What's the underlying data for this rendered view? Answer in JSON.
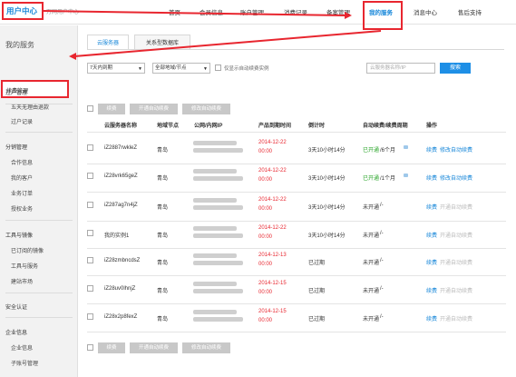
{
  "header": {
    "logo": "用户中心",
    "logo_sub": "万网用户中心",
    "nav": [
      "首页",
      "会员信息",
      "账户管理",
      "消费记录",
      "备案管理",
      "我的服务",
      "消息中心",
      "售后支持"
    ]
  },
  "sidebar": {
    "title": "我的服务",
    "active": "续费管理",
    "items": [
      "过户管理",
      "五天无理由退款",
      "过户记录",
      "分销管理",
      "合作信息",
      "我的客户",
      "业务订单",
      "授权业务",
      "工具与镜像",
      "已订阅的镜像",
      "工具与服务",
      "建站市场",
      "安全认证",
      "企业信息",
      "企业信息",
      "子账号管理"
    ]
  },
  "tabs": [
    "云服务器",
    "关系型数据库"
  ],
  "filters": {
    "expire_select": "7天内到期",
    "region_select": "全部地域/节点",
    "only_auto_label": "仅显示自动续费实例",
    "search_placeholder": "云服务器名称/IP",
    "search_button": "搜索"
  },
  "bulk_actions": [
    "续费",
    "开通自动续费",
    "修改自动续费"
  ],
  "table": {
    "columns": [
      "云服务器名称",
      "地域节点",
      "公网/内网IP",
      "产品到期时间",
      "倒计时",
      "自动续费/续费周期",
      "操作"
    ],
    "rows": [
      {
        "name": "iZ2887rwkleZ",
        "region": "青岛",
        "expire_date": "2014-12-22",
        "expire_time": "00:00",
        "countdown": "3天10小时14分",
        "auto": "已开通",
        "period": "/6个月",
        "actions": [
          "续费",
          "修改自动续费"
        ]
      },
      {
        "name": "iZ28vrk65geZ",
        "region": "青岛",
        "expire_date": "2014-12-22",
        "expire_time": "00:00",
        "countdown": "3天10小时14分",
        "auto": "已开通",
        "period": "/1个月",
        "actions": [
          "续费",
          "修改自动续费"
        ]
      },
      {
        "name": "iZ287ag7n4jZ",
        "region": "青岛",
        "expire_date": "2014-12-22",
        "expire_time": "00:00",
        "countdown": "3天10小时14分",
        "auto": "未开通",
        "period": "/-",
        "actions": [
          "续费",
          "开通自动续费"
        ]
      },
      {
        "name": "我的实例1",
        "region": "青岛",
        "expire_date": "2014-12-22",
        "expire_time": "00:00",
        "countdown": "3天10小时14分",
        "auto": "未开通",
        "period": "/-",
        "actions": [
          "续费",
          "开通自动续费"
        ]
      },
      {
        "name": "iZ28zmbncdsZ",
        "region": "青岛",
        "expire_date": "2014-12-13",
        "expire_time": "00:00",
        "countdown": "已过期",
        "auto": "未开通",
        "period": "/-",
        "actions": [
          "续费",
          "开通自动续费"
        ]
      },
      {
        "name": "iZ28uv0lhnjZ",
        "region": "青岛",
        "expire_date": "2014-12-15",
        "expire_time": "00:00",
        "countdown": "已过期",
        "auto": "未开通",
        "period": "/-",
        "actions": [
          "续费",
          "开通自动续费"
        ]
      },
      {
        "name": "iZ28x2p8fexZ",
        "region": "青岛",
        "expire_date": "2014-12-15",
        "expire_time": "00:00",
        "countdown": "已过期",
        "auto": "未开通",
        "period": "/-",
        "actions": [
          "续费",
          "开通自动续费"
        ]
      }
    ]
  },
  "colors": {
    "brand": "#1787d9",
    "highlight": "#e8262f",
    "enabled": "#2aa52a"
  }
}
